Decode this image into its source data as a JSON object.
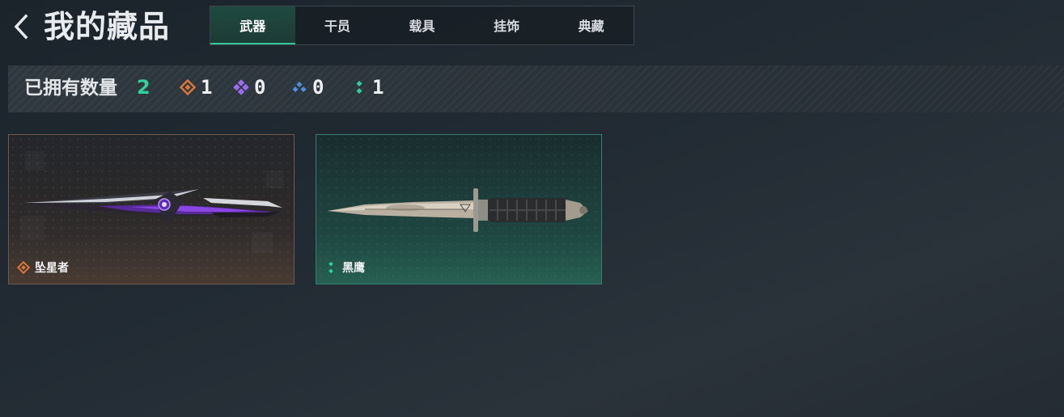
{
  "header": {
    "title": "我的藏品",
    "tabs": [
      {
        "label": "武器",
        "active": true
      },
      {
        "label": "干员",
        "active": false
      },
      {
        "label": "载具",
        "active": false
      },
      {
        "label": "挂饰",
        "active": false
      },
      {
        "label": "典藏",
        "active": false
      }
    ]
  },
  "stats": {
    "label": "已拥有数量",
    "total": "2",
    "counts": [
      {
        "icon": "orange-rarity-icon",
        "color": "#e0773a",
        "value": "1"
      },
      {
        "icon": "purple-rarity-icon",
        "color": "#9a6cf0",
        "value": "0"
      },
      {
        "icon": "blue-rarity-icon",
        "color": "#4a8fe0",
        "value": "0"
      },
      {
        "icon": "green-rarity-icon",
        "color": "#2fcf9a",
        "value": "1"
      }
    ]
  },
  "items": [
    {
      "name": "坠星者",
      "icon": "orange-rarity-icon",
      "color": "#e0773a"
    },
    {
      "name": "黑鹰",
      "icon": "green-rarity-icon",
      "color": "#2fcf9a"
    }
  ]
}
